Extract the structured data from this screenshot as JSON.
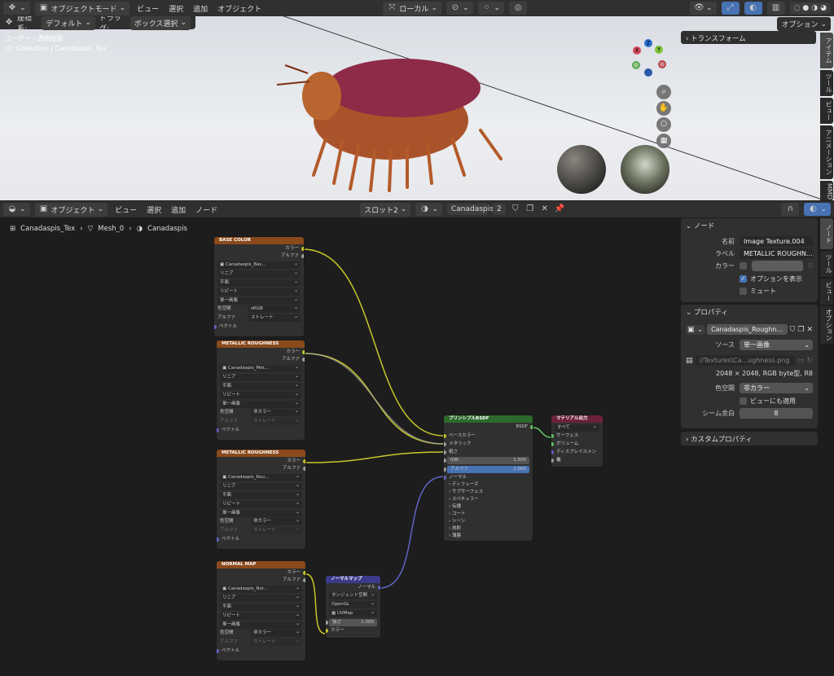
{
  "top_header": {
    "mode": "オブジェクトモード",
    "menus": [
      "ビュー",
      "選択",
      "追加",
      "オブジェクト"
    ],
    "orientation": "ローカル"
  },
  "viewport_header": {
    "coord_label": "座標系:",
    "coord_value": "デフォルト",
    "drag_label": "ドラッグ:",
    "drag_value": "ボックス選択",
    "options": "オプション"
  },
  "viewport": {
    "view_name": "ユーザー・透視投影",
    "collection": "(1) Collection | Canadaspis_Tex",
    "n_panel_title": "トランスフォーム",
    "tabs": [
      "アイテム",
      "ツール",
      "ビュー",
      "アニメーション",
      "MMD"
    ],
    "gizmo": {
      "x": "X",
      "y": "Y",
      "z": "Z"
    }
  },
  "node_header": {
    "editor_mode": "オブジェクト",
    "menus": [
      "ビュー",
      "選択",
      "追加",
      "ノード"
    ],
    "slot": "スロット2",
    "material": "Canadaspis",
    "users": "2"
  },
  "breadcrumb": [
    "Canadaspis_Tex",
    "Mesh_0",
    "Canadaspis"
  ],
  "nodes": {
    "base_color": {
      "title": "BASE COLOR",
      "out_color": "カラー",
      "out_alpha": "アルファ",
      "image": "Canadaspis_Bas...",
      "interp": "リニア",
      "proj": "平面",
      "ext": "リピート",
      "source": "単一画像",
      "cs_label": "色空間",
      "cs_value": "sRGB",
      "alpha_label": "アルファ",
      "alpha_value": "ストレート",
      "vector": "ベクトル"
    },
    "metallic1": {
      "title": "METALLIC ROUGHNESS",
      "out_color": "カラー",
      "out_alpha": "アルファ",
      "image": "Canadaspis_Met...",
      "interp": "リニア",
      "proj": "平面",
      "ext": "リピート",
      "source": "単一画像",
      "cs_label": "色空間",
      "cs_value": "非カラー",
      "alpha_label": "アルファ",
      "alpha_value": "ストレート",
      "vector": "ベクトル"
    },
    "metallic2": {
      "title": "METALLIC ROUGHNESS",
      "out_color": "カラー",
      "out_alpha": "アルファ",
      "image": "Canadaspis_Rou...",
      "interp": "リニア",
      "proj": "平面",
      "ext": "リピート",
      "source": "単一画像",
      "cs_label": "色空間",
      "cs_value": "非カラー",
      "alpha_label": "アルファ",
      "alpha_value": "ストレート",
      "vector": "ベクトル"
    },
    "normal_map_tex": {
      "title": "NORMAL MAP",
      "out_color": "カラー",
      "out_alpha": "アルファ",
      "image": "Canadaspis_Nor...",
      "interp": "リニア",
      "proj": "平面",
      "ext": "リピート",
      "source": "単一画像",
      "cs_label": "色空間",
      "cs_value": "非カラー",
      "alpha_label": "アルファ",
      "alpha_value": "ストレート",
      "vector": "ベクトル"
    },
    "principled": {
      "title": "プリンシプルBSDF",
      "out": "BSDF",
      "base": "ベースカラー",
      "metallic": "メタリック",
      "rough": "粗さ",
      "ior_label": "IOR",
      "ior": "1.500",
      "alpha_label": "アルファ",
      "alpha": "1.000",
      "normal": "ノーマル",
      "subs": [
        "ディフューズ",
        "サブサーフェス",
        "スペキュラー",
        "伝播",
        "コート",
        "シーン",
        "放射",
        "薄膜"
      ]
    },
    "normal_map": {
      "title": "ノーマルマップ",
      "out": "ノーマル",
      "space": "タンジェント空間",
      "conv": "OpenGL",
      "uv": "UVMap",
      "str_label": "強さ",
      "str": "1.000",
      "color": "カラー"
    },
    "output": {
      "title": "マテリアル出力",
      "target": "すべて",
      "surface": "サーフェス",
      "volume": "ボリューム",
      "disp": "ディスプレイスメント",
      "thick": "幅"
    }
  },
  "sidebar": {
    "node_section": "ノード",
    "name_label": "名前",
    "name_value": "Image Texture.004",
    "label_label": "ラベル",
    "label_value": "METALLIC ROUGHN...",
    "color_label": "カラー",
    "show_options": "オプションを表示",
    "mute": "ミュート",
    "props_section": "プロパティ",
    "image": "Canadaspis_Roughn...",
    "source_label": "ソース",
    "source_value": "単一画像",
    "path": "//Textures\\Ca...ughness.png",
    "info": "2048 × 2048, RGB byte型, R8",
    "cs_label": "色空間",
    "cs_value": "非カラー",
    "view_apply": "ビューにも適用",
    "seam_label": "シーム余白",
    "seam_value": "8",
    "custom": "カスタムプロパティ",
    "tabs": [
      "ノード",
      "ツール",
      "ビュー",
      "オプション"
    ]
  }
}
